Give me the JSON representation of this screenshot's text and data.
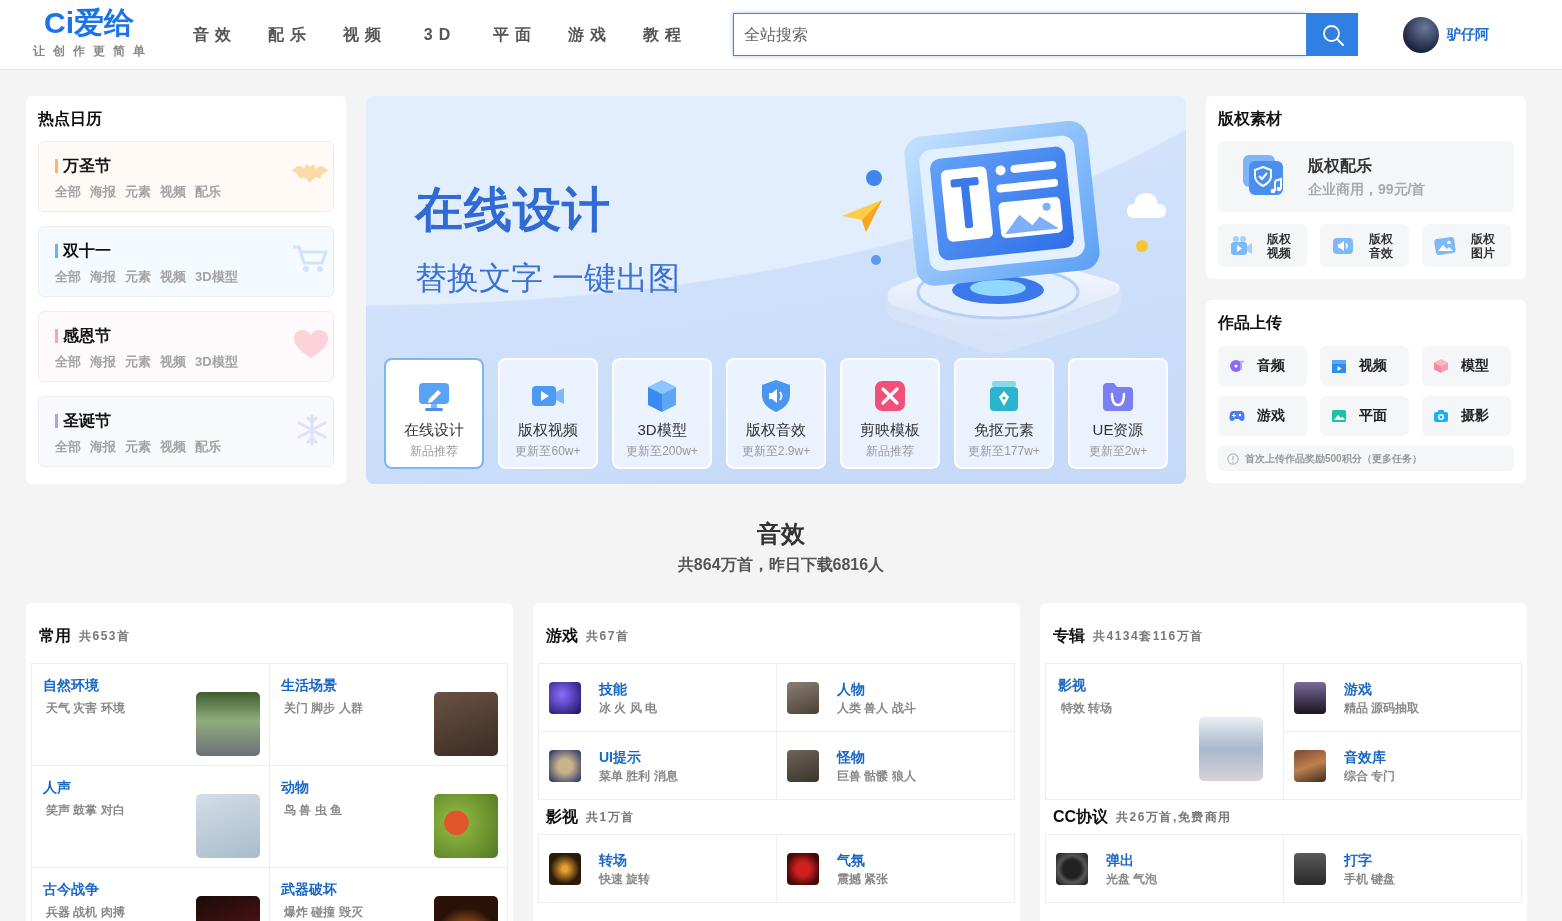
{
  "header": {
    "logo": "Ci爱给",
    "slogan": "让创作更简单",
    "nav": [
      "音效",
      "配乐",
      "视频",
      "3D",
      "平面",
      "游戏",
      "教程"
    ],
    "search": {
      "placeholder": "全站搜索"
    },
    "user": {
      "name": "驴仔阿"
    }
  },
  "calendar": {
    "title": "热点日历",
    "items": [
      {
        "title": "万圣节",
        "color": "#f9b66c",
        "tags": [
          "全部",
          "海报",
          "元素",
          "视频",
          "配乐"
        ]
      },
      {
        "title": "双十一",
        "color": "#6ab2f2",
        "tags": [
          "全部",
          "海报",
          "元素",
          "视频",
          "3D模型"
        ]
      },
      {
        "title": "感恩节",
        "color": "#f7a9b2",
        "tags": [
          "全部",
          "海报",
          "元素",
          "视频",
          "3D模型"
        ]
      },
      {
        "title": "圣诞节",
        "color": "#a2a8e6",
        "tags": [
          "全部",
          "海报",
          "元素",
          "视频",
          "配乐"
        ]
      }
    ]
  },
  "banner": {
    "title": "在线设计",
    "subtitle": "替换文字 一键出图",
    "cards": [
      {
        "title": "在线设计",
        "note": "新品推荐",
        "selected": true
      },
      {
        "title": "版权视频",
        "note": "更新至60w+",
        "selected": false
      },
      {
        "title": "3D模型",
        "note": "更新至200w+",
        "selected": false
      },
      {
        "title": "版权音效",
        "note": "更新至2.9w+",
        "selected": false
      },
      {
        "title": "剪映模板",
        "note": "新品推荐",
        "selected": false
      },
      {
        "title": "免抠元素",
        "note": "更新至177w+",
        "selected": false
      },
      {
        "title": "UE资源",
        "note": "更新至2w+",
        "selected": false
      }
    ]
  },
  "copyright": {
    "title": "版权素材",
    "feature": {
      "title": "版权配乐",
      "note": "企业商用，99元/首"
    },
    "tiles": [
      "版权视频",
      "版权音效",
      "版权图片"
    ]
  },
  "upload": {
    "title": "作品上传",
    "tiles": [
      "音频",
      "视频",
      "模型",
      "游戏",
      "平面",
      "摄影"
    ],
    "tip": "首次上传作品奖励500积分（更多任务）"
  },
  "section": {
    "title": "音效",
    "summary": "共864万首，昨日下载6816人"
  },
  "panels": [
    {
      "groups": [
        {
          "title": "常用",
          "count": "共653首",
          "items": [
            {
              "kind": "large",
              "title": "自然环境",
              "tags": "天气 灾害 环境"
            },
            {
              "kind": "large",
              "title": "生活场景",
              "tags": "关门 脚步 人群"
            },
            {
              "kind": "large",
              "title": "人声",
              "tags": "笑声 鼓掌 对白"
            },
            {
              "kind": "large",
              "title": "动物",
              "tags": "鸟 兽 虫 鱼"
            },
            {
              "kind": "large",
              "title": "古今战争",
              "tags": "兵器 战机 肉搏"
            },
            {
              "kind": "large",
              "title": "武器破坏",
              "tags": "爆炸 碰撞 毁灭"
            }
          ]
        }
      ]
    },
    {
      "groups": [
        {
          "title": "游戏",
          "count": "共67首",
          "items": [
            {
              "kind": "small",
              "title": "技能",
              "tags": "冰 火 风 电"
            },
            {
              "kind": "small",
              "title": "人物",
              "tags": "人类 兽人 战斗"
            },
            {
              "kind": "small",
              "title": "UI提示",
              "tags": "菜单 胜利 消息"
            },
            {
              "kind": "small",
              "title": "怪物",
              "tags": "巨兽 骷髅 狼人"
            }
          ]
        },
        {
          "title": "影视",
          "count": "共1万首",
          "items": [
            {
              "kind": "small",
              "title": "转场",
              "tags": "快速 旋转"
            },
            {
              "kind": "small",
              "title": "气氛",
              "tags": "震撼 紧张"
            }
          ]
        }
      ]
    },
    {
      "groups": [
        {
          "title": "专辑",
          "count": "共4134套116万首",
          "items": [
            {
              "kind": "tall",
              "title": "影视",
              "tags": "特效 转场"
            },
            {
              "kind": "small",
              "title": "游戏",
              "tags": "精品 源码抽取"
            },
            {
              "kind": "small",
              "title": "音效库",
              "tags": "综合 专门"
            }
          ]
        },
        {
          "title": "CC协议",
          "count": "共26万首,免费商用",
          "items": [
            {
              "kind": "small",
              "title": "弹出",
              "tags": "光盘 气泡"
            },
            {
              "kind": "small",
              "title": "打字",
              "tags": "手机 键盘"
            }
          ]
        }
      ]
    }
  ]
}
